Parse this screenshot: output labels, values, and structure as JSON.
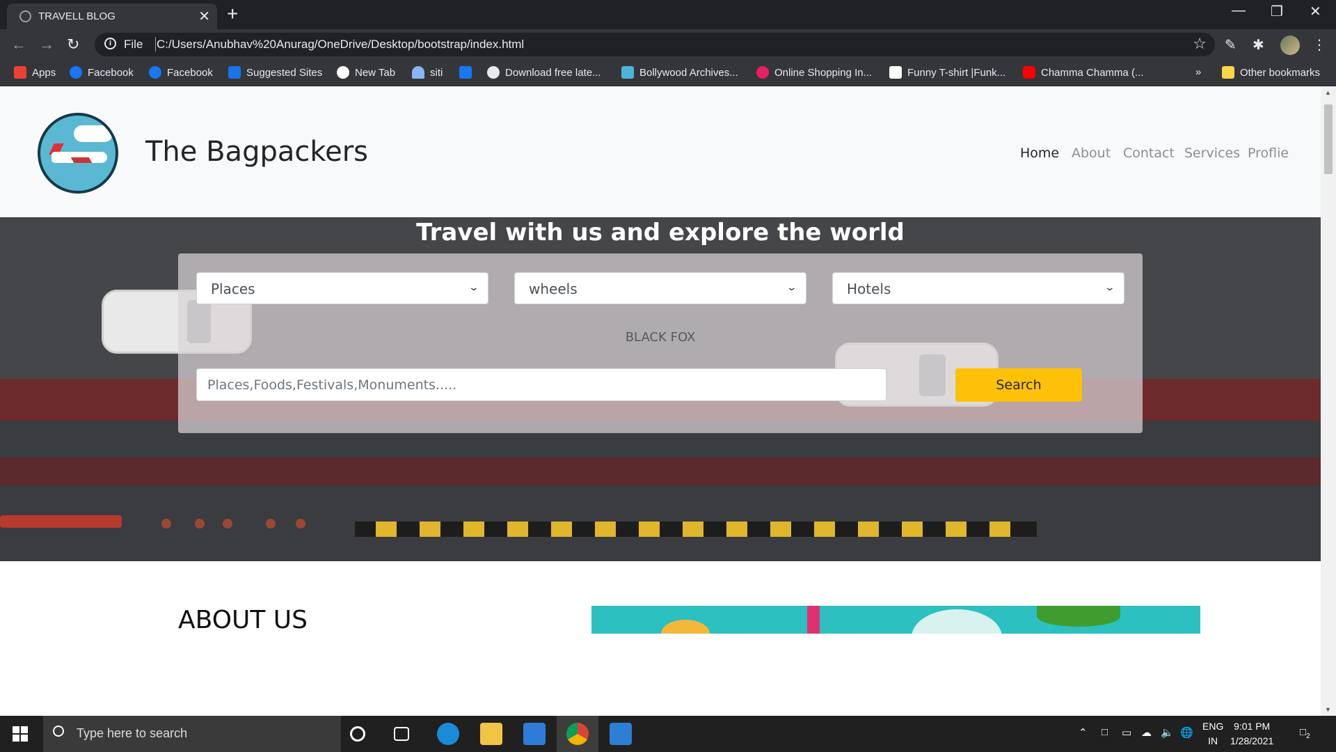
{
  "browser": {
    "tab_title": "TRAVELL BLOG",
    "new_tab_symbol": "+",
    "close_tab_symbol": "✕",
    "url_scheme": "File",
    "url": "C:/Users/Anubhav%20Anurag/OneDrive/Desktop/bootstrap/index.html",
    "bookmarks": [
      {
        "label": "Apps",
        "color": "#e94235"
      },
      {
        "label": "Facebook",
        "color": "#1877f2"
      },
      {
        "label": "Facebook",
        "color": "#1877f2"
      },
      {
        "label": "Suggested Sites",
        "color": "#1a73e8"
      },
      {
        "label": "New Tab",
        "color": "#ffffff"
      },
      {
        "label": "siti",
        "color": "#8ab4f8"
      },
      {
        "label": "",
        "color": "#1877f2"
      },
      {
        "label": "Download free late...",
        "color": "#e8eaed"
      },
      {
        "label": "Bollywood Archives...",
        "color": "#4fb3d9"
      },
      {
        "label": "Online Shopping In...",
        "color": "#e91e63"
      },
      {
        "label": "Funny T-shirt |Funk...",
        "color": "#ffffff"
      },
      {
        "label": "Chamma Chamma (...",
        "color": "#ff0000"
      }
    ],
    "overflow_symbol": "»",
    "other_bookmarks": "Other bookmarks"
  },
  "site": {
    "brand": "The Bagpackers",
    "nav": [
      "Home",
      "About",
      "Contact",
      "Services",
      "Proflie"
    ],
    "hero_title": "Travel with us and explore the world",
    "selects": [
      "Places",
      "wheels",
      "Hotels"
    ],
    "panel_label": "BLACK FOX",
    "search_placeholder": "Places,Foods,Festivals,Monuments.....",
    "search_button": "Search",
    "about_title": "ABOUT US"
  },
  "taskbar": {
    "search_placeholder": "Type here to search",
    "lang_top": "ENG",
    "lang_bottom": "IN",
    "time": "9:01 PM",
    "date": "1/28/2021",
    "notifications": "2"
  },
  "colors": {
    "accent_button": "#ffc107",
    "browser_dark": "#202124"
  }
}
